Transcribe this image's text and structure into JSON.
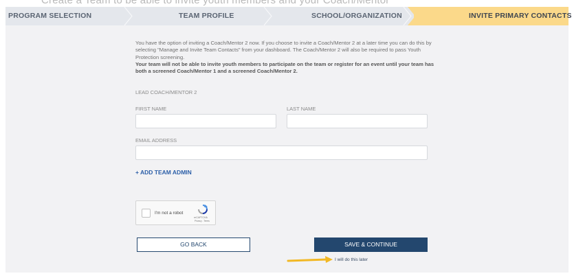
{
  "header_strip_text": "Create a Team to be able to invite youth members and your Coach/Mentor",
  "steps": [
    {
      "label": "PROGRAM SELECTION"
    },
    {
      "label": "TEAM PROFILE"
    },
    {
      "label": "SCHOOL/ORGANIZATION"
    },
    {
      "label": "INVITE PRIMARY CONTACTS"
    }
  ],
  "active_step": "INVITE PRIMARY CONTACTS",
  "intro": {
    "text": "You have the option of inviting  a Coach/Mentor 2 now.  If you choose to invite a Coach/Mentor 2 at a later time you can do this by selecting \"Manage and Invite Team Contacts\" from your dashboard.  The Coach/Mentor 2 will also be required to pass Youth Protection screening.",
    "bold_text": "Your team will not be able to invite youth members to participate on the team or register for an event until your team has both a screened Coach/Mentor 1 and a screened Coach/Mentor 2."
  },
  "form": {
    "section_title": "LEAD COACH/MENTOR 2",
    "first_name_label": "FIRST NAME",
    "first_name_value": "",
    "last_name_label": "LAST NAME",
    "last_name_value": "",
    "email_label": "EMAIL ADDRESS",
    "email_value": "",
    "add_admin_link": "+ ADD TEAM ADMIN"
  },
  "captcha": {
    "label": "I'm not a robot",
    "brand": "reCAPTCHA",
    "terms": "Privacy - Terms",
    "icon": "recaptcha-icon"
  },
  "buttons": {
    "back": "GO BACK",
    "save": "SAVE & CONTINUE"
  },
  "later_link": "I will do this later",
  "annotation": {
    "icon": "arrow-right-icon",
    "color": "#f2b824"
  },
  "colors": {
    "step_bar": "#e4e7ec",
    "step_active": "#fbd98a",
    "navy": "#23476e",
    "link_blue": "#2c5fa8",
    "panel": "#f2f2f4"
  }
}
